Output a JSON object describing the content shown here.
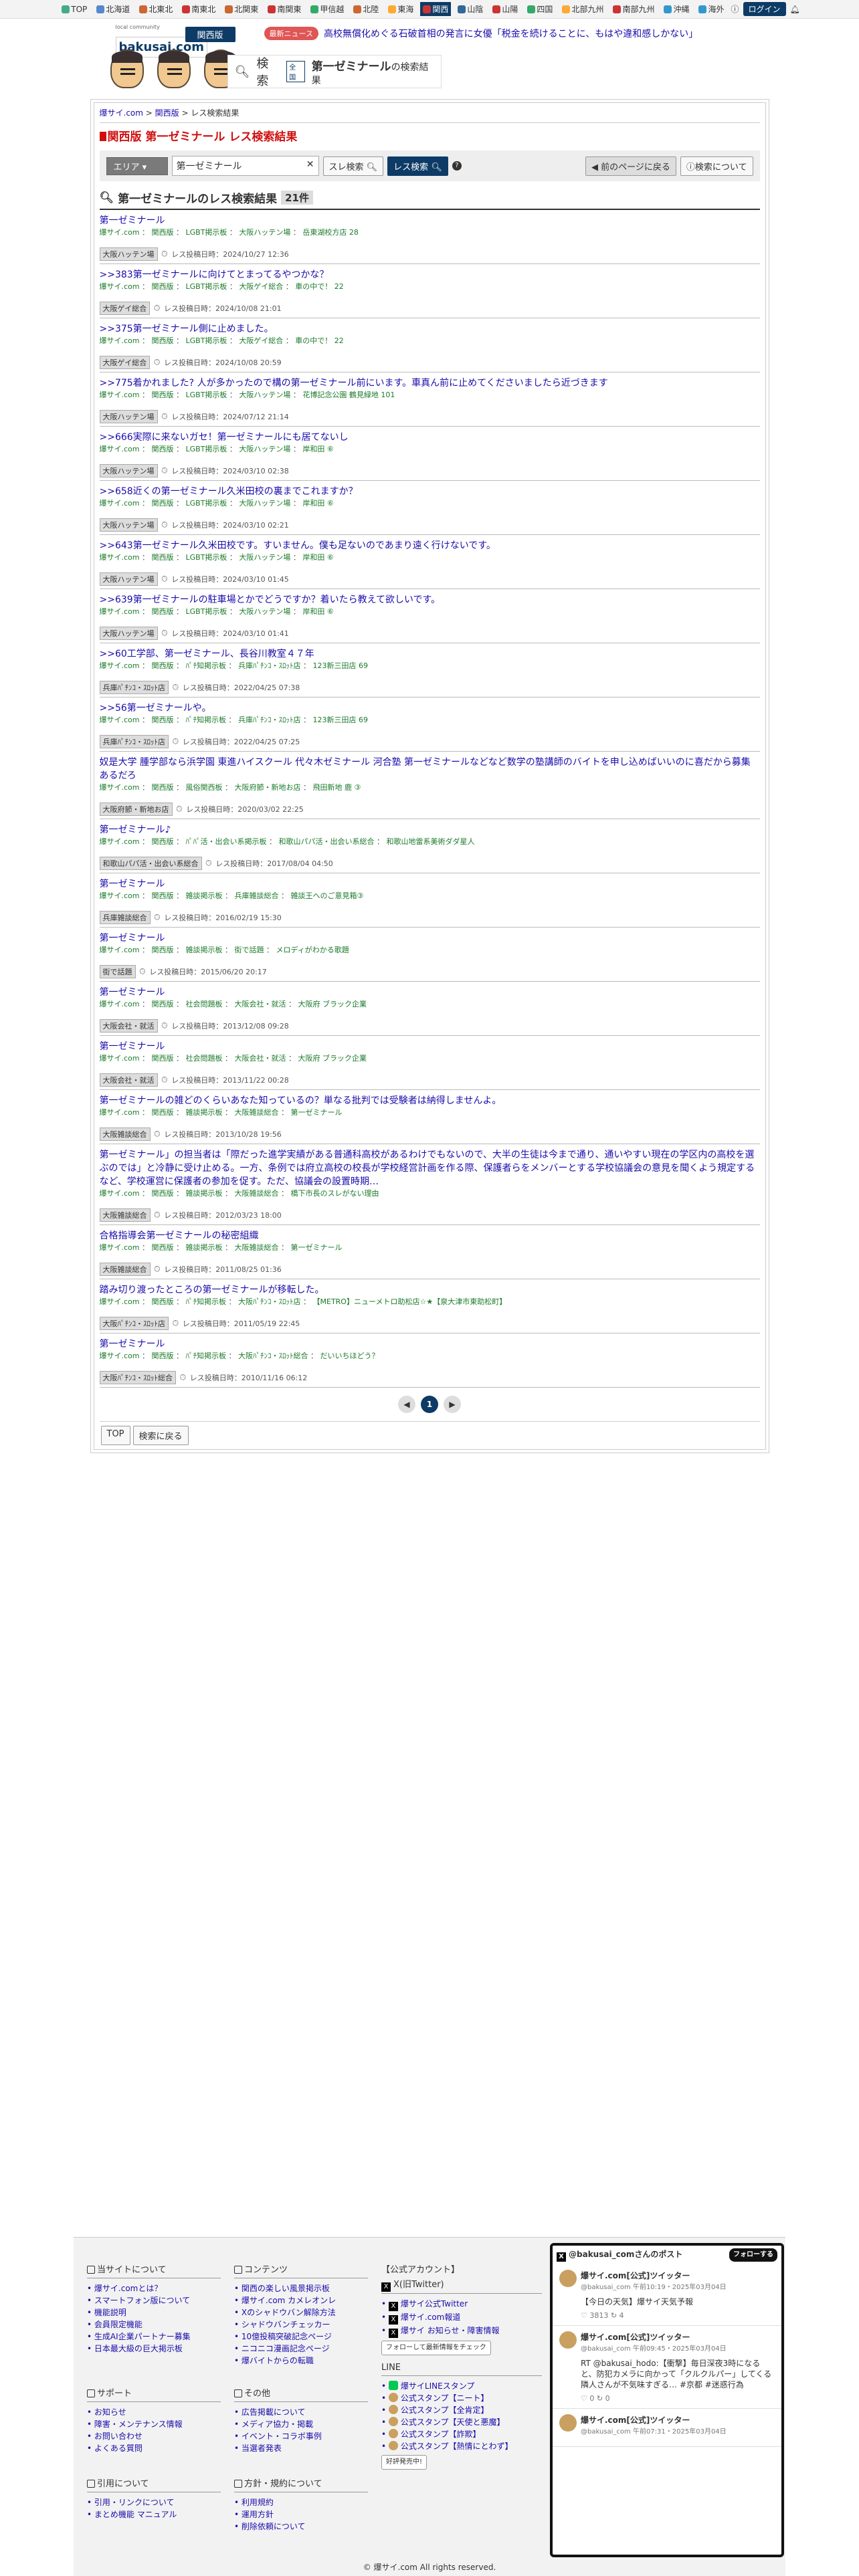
{
  "topbar": {
    "items": [
      {
        "label": "TOP",
        "color": "#4a8"
      },
      {
        "label": "北海道",
        "color": "#58c"
      },
      {
        "label": "北東北",
        "color": "#c63"
      },
      {
        "label": "南東北",
        "color": "#c33"
      },
      {
        "label": "北関東",
        "color": "#c63"
      },
      {
        "label": "南関東",
        "color": "#c33"
      },
      {
        "label": "甲信越",
        "color": "#3a6"
      },
      {
        "label": "北陸",
        "color": "#c63"
      },
      {
        "label": "東海",
        "color": "#fa3"
      },
      {
        "label": "関西",
        "color": "#c33",
        "active": true
      },
      {
        "label": "山陰",
        "color": "#369"
      },
      {
        "label": "山陽",
        "color": "#c33"
      },
      {
        "label": "四国",
        "color": "#3a6"
      },
      {
        "label": "北部九州",
        "color": "#fa3"
      },
      {
        "label": "南部九州",
        "color": "#c33"
      },
      {
        "label": "沖縄",
        "color": "#39c"
      },
      {
        "label": "海外",
        "color": "#39c"
      }
    ],
    "login": "ログイン"
  },
  "header": {
    "logo_tag": "local community",
    "logo": "bakusai.com",
    "region": "関西版",
    "news_badge": "最新ニュース",
    "news_text": "高校無償化めぐる石破首相の発言に女優「税金を続けることに、もはや違和感しかない」",
    "search_label": "検索",
    "search_all": "全国",
    "search_kw": "第一ゼミナール",
    "search_suffix": "の検索結果"
  },
  "crumb": [
    "爆サイ.com",
    "関西版",
    "レス検索結果"
  ],
  "page_title": "関西版 第一ゼミナール レス検索結果",
  "searchbar": {
    "area": "エリア",
    "query": "第一ゼミナール",
    "btn_thread": "スレ検索",
    "btn_res": "レス検索",
    "help": "?",
    "btn_back": "前のページに戻る",
    "btn_about": "検索について"
  },
  "results_title": "第一ゼミナールのレス検索結果",
  "results_count": "21件",
  "results": [
    {
      "title": "第一ゼミナール",
      "site": "爆サイ.com",
      "path": "関西版",
      "board": "LGBT掲示板",
      "sub": "大阪ハッテン場",
      "thread": "岳東湖校方店 28",
      "tag": "大阪ハッテン場",
      "date": "レス投稿日時：2024/10/27 12:36"
    },
    {
      "title": ">>383第一ゼミナールに向けてとまってるやつかな？",
      "site": "爆サイ.com",
      "path": "関西版",
      "board": "LGBT掲示板",
      "sub": "大阪ゲイ総合",
      "thread": "車の中で！ 22",
      "tag": "大阪ゲイ総合",
      "date": "レス投稿日時：2024/10/08 21:01"
    },
    {
      "title": ">>375第一ゼミナール側に止めました。",
      "site": "爆サイ.com",
      "path": "関西版",
      "board": "LGBT掲示板",
      "sub": "大阪ゲイ総合",
      "thread": "車の中で！ 22",
      "tag": "大阪ゲイ総合",
      "date": "レス投稿日時：2024/10/08 20:59"
    },
    {
      "title": ">>775着かれました? 人が多かったので構の第一ゼミナール前にいます。車真ん前に止めてくださいましたら近づきます",
      "site": "爆サイ.com",
      "path": "関西版",
      "board": "LGBT掲示板",
      "sub": "大阪ハッテン場",
      "thread": "花博記念公園 鶴見緑地 101",
      "tag": "大阪ハッテン場",
      "date": "レス投稿日時：2024/07/12 21:14"
    },
    {
      "title": ">>666実際に来ないガセ！第一ゼミナールにも居てないし",
      "site": "爆サイ.com",
      "path": "関西版",
      "board": "LGBT掲示板",
      "sub": "大阪ハッテン場",
      "thread": "岸和田 ⑥",
      "tag": "大阪ハッテン場",
      "date": "レス投稿日時：2024/03/10 02:38"
    },
    {
      "title": ">>658近くの第一ゼミナール久米田校の裏までこれますか？",
      "site": "爆サイ.com",
      "path": "関西版",
      "board": "LGBT掲示板",
      "sub": "大阪ハッテン場",
      "thread": "岸和田 ⑥",
      "tag": "大阪ハッテン場",
      "date": "レス投稿日時：2024/03/10 02:21"
    },
    {
      "title": ">>643第一ゼミナール久米田校です。すいません。僕も足ないのであまり遠く行けないです。",
      "site": "爆サイ.com",
      "path": "関西版",
      "board": "LGBT掲示板",
      "sub": "大阪ハッテン場",
      "thread": "岸和田 ⑥",
      "tag": "大阪ハッテン場",
      "date": "レス投稿日時：2024/03/10 01:45"
    },
    {
      "title": ">>639第一ゼミナールの駐車場とかでどうですか？着いたら教えて欲しいです。",
      "site": "爆サイ.com",
      "path": "関西版",
      "board": "LGBT掲示板",
      "sub": "大阪ハッテン場",
      "thread": "岸和田 ⑥",
      "tag": "大阪ハッテン場",
      "date": "レス投稿日時：2024/03/10 01:41"
    },
    {
      "title": ">>60工学部、第一ゼミナール、長谷川教室４７年",
      "site": "爆サイ.com",
      "path": "関西版",
      "board": "ﾊﾟﾁ知掲示板",
      "sub": "兵庫ﾊﾟﾁﾝｺ・ｽﾛｯﾄ店",
      "thread": "123新三田店 69",
      "tag": "兵庫ﾊﾟﾁﾝｺ・ｽﾛｯﾄ店",
      "date": "レス投稿日時：2022/04/25 07:38"
    },
    {
      "title": ">>56第一ゼミナールや。",
      "site": "爆サイ.com",
      "path": "関西版",
      "board": "ﾊﾟﾁ知掲示板",
      "sub": "兵庫ﾊﾟﾁﾝｺ・ｽﾛｯﾄ店",
      "thread": "123新三田店 69",
      "tag": "兵庫ﾊﾟﾁﾝｺ・ｽﾛｯﾄ店",
      "date": "レス投稿日時：2022/04/25 07:25"
    },
    {
      "title": "奴是大学 腫学部なら浜学園 東進ハイスクール 代々木ゼミナール 河合塾 第一ゼミナールなどなど数学の塾講師のバイトを申し込めばいいのに喜だから募集あるだろ",
      "site": "爆サイ.com",
      "path": "関西版",
      "board": "風俗関西板",
      "sub": "大阪府節・新地お店",
      "thread": "飛田新地 鹿 ③",
      "tag": "大阪府節・新地お店",
      "date": "レス投稿日時：2020/03/02 22:25"
    },
    {
      "title": "第一ゼミナール♪",
      "site": "爆サイ.com",
      "path": "関西版",
      "board": "ﾊﾟﾊﾟ活・出会い系掲示板",
      "sub": "和歌山パパ活・出会い系総合",
      "thread": "和歌山地雷系美術ダダ星人",
      "tag": "和歌山パパ活・出会い系総合",
      "date": "レス投稿日時：2017/08/04 04:50"
    },
    {
      "title": "第一ゼミナール",
      "site": "爆サイ.com",
      "path": "関西版",
      "board": "雑談掲示板",
      "sub": "兵庫雑談総合",
      "thread": "雑談王へのご意見箱③",
      "tag": "兵庫雑談総合",
      "date": "レス投稿日時：2016/02/19 15:30"
    },
    {
      "title": "第一ゼミナール",
      "site": "爆サイ.com",
      "path": "関西版",
      "board": "雑談掲示板",
      "sub": "街で話題",
      "thread": "メロディがわかる歌題",
      "tag": "街で話題",
      "date": "レス投稿日時：2015/06/20 20:17"
    },
    {
      "title": "第一ゼミナール",
      "site": "爆サイ.com",
      "path": "関西版",
      "board": "社会問題板",
      "sub": "大阪会社・就活",
      "thread": "大阪府 ブラック企業",
      "tag": "大阪会社・就活",
      "date": "レス投稿日時：2013/12/08 09:28"
    },
    {
      "title": "第一ゼミナール",
      "site": "爆サイ.com",
      "path": "関西版",
      "board": "社会問題板",
      "sub": "大阪会社・就活",
      "thread": "大阪府 ブラック企業",
      "tag": "大阪会社・就活",
      "date": "レス投稿日時：2013/11/22 00:28"
    },
    {
      "title": "第一ゼミナールの雑どのくらいあなた知っているの？単なる批判では受験者は納得しませんよ。",
      "site": "爆サイ.com",
      "path": "関西版",
      "board": "雑談掲示板",
      "sub": "大阪雑談総合",
      "thread": "第一ゼミナール",
      "tag": "大阪雑談総合",
      "date": "レス投稿日時：2013/10/28 19:56"
    },
    {
      "title": "第一ゼミナール」の担当者は「際だった進学実績がある普通科高校があるわけでもないので、大半の生徒は今まで通り、通いやすい現在の学区内の高校を選ぶのでは」と冷静に受け止める。一方、条例では府立高校の校長が学校経営計画を作る際、保護者らをメンバーとする学校協議会の意見を聞くよう規定するなど、学校運営に保護者の参加を促す。ただ、協議会の設置時期…",
      "site": "爆サイ.com",
      "path": "関西版",
      "board": "雑談掲示板",
      "sub": "大阪雑談総合",
      "thread": "橋下市長のスレがない理由",
      "tag": "大阪雑談総合",
      "date": "レス投稿日時：2012/03/23 18:00"
    },
    {
      "title": "合格指導会第一ゼミナールの秘密組織",
      "site": "爆サイ.com",
      "path": "関西版",
      "board": "雑談掲示板",
      "sub": "大阪雑談総合",
      "thread": "第一ゼミナール",
      "tag": "大阪雑談総合",
      "date": "レス投稿日時：2011/08/25 01:36"
    },
    {
      "title": "踏み切り渡ったところの第一ゼミナールが移転した。",
      "site": "爆サイ.com",
      "path": "関西版",
      "board": "ﾊﾟﾁ知掲示板",
      "sub": "大阪ﾊﾟﾁﾝｺ・ｽﾛｯﾄ店",
      "thread": "【METRO】ニューメトロ助松店☆★【泉大津市東助松町】",
      "tag": "大阪ﾊﾟﾁﾝｺ・ｽﾛｯﾄ店",
      "date": "レス投稿日時：2011/05/19 22:45"
    },
    {
      "title": "第一ゼミナール",
      "site": "爆サイ.com",
      "path": "関西版",
      "board": "ﾊﾟﾁ知掲示板",
      "sub": "大阪ﾊﾟﾁﾝｺ・ｽﾛｯﾄ総合",
      "thread": "だいいちほどう？",
      "tag": "大阪ﾊﾟﾁﾝｺ・ｽﾛｯﾄ総合",
      "date": "レス投稿日時：2010/11/16 06:12"
    }
  ],
  "pager": {
    "current": "1"
  },
  "bottom_nav": [
    "TOP",
    "検索に戻る"
  ],
  "footer": {
    "about": {
      "title": "当サイトについて",
      "links": [
        "爆サイ.comとは？",
        "スマートフォン版について",
        "機能説明",
        "会員限定機能",
        "生成AI企業パートナー募集",
        "日本最大級の巨大掲示板"
      ]
    },
    "contents": {
      "title": "コンテンツ",
      "links": [
        "関西の楽しい風景掲示板",
        "爆サイ.com カメレオンレ",
        "Xのシャドウバン解除方法",
        "シャドウバンチェッカー",
        "10億投稿突破記念ページ",
        "ニコニコ漫画記念ページ",
        "爆バイトからの転職"
      ]
    },
    "support": {
      "title": "サポート",
      "links": [
        "お知らせ",
        "障害・メンテナンス情報",
        "お問い合わせ",
        "よくある質問"
      ]
    },
    "other": {
      "title": "その他",
      "links": [
        "広告掲載について",
        "メディア協力・掲載",
        "イベント・コラボ事例",
        "当選者発表"
      ]
    },
    "links": {
      "title": "引用について",
      "links": [
        "引用・リンクについて",
        "まとめ機能 マニュアル"
      ]
    },
    "policy": {
      "title": "方針・規約について",
      "links": [
        "利用規約",
        "運用方針",
        "削除依頼について"
      ]
    },
    "accounts_title": "【公式アカウント】",
    "x_title": "X(旧Twitter)",
    "x_links": [
      "爆サイ公式Twitter",
      "爆サイ.com報道",
      "爆サイ お知らせ・障害情報"
    ],
    "follow_btn": "フォローして最新情報をチェック",
    "line_title": "LINE",
    "line_links": [
      "爆サイLINEスタンプ",
      "公式スタンプ【ニート】",
      "公式スタンプ【全肯定】",
      "公式スタンプ【天使と悪魔】",
      "公式スタンプ【詐欺】",
      "公式スタンプ【熱情にとわず】"
    ],
    "sale_btn": "好評発売中!",
    "tw_header": "@bakusai_comさんのポスト",
    "tw_follow": "フォローする",
    "tweets": [
      {
        "name": "爆サイ.com[公式]ツイッター",
        "handle": "@bakusai_com 午前10:19・2025年03月04日",
        "body": "【今日の天気】爆サイ天気予報",
        "stats": "♡ 3813   ↻ 4"
      },
      {
        "name": "爆サイ.com[公式]ツイッター",
        "handle": "@bakusai_com 午前09:45・2025年03月04日",
        "body": "RT @bakusai_hodo:【衝撃】毎日深夜3時になると、防犯カメラに向かって「クルクルパー」してくる隣人さんが不気味すぎる… #京都 #迷惑行為",
        "stats": "♡ 0   ↻ 0"
      },
      {
        "name": "爆サイ.com[公式]ツイッター",
        "handle": "@bakusai_com 午前07:31・2025年03月04日",
        "body": "",
        "stats": ""
      }
    ],
    "copyright": "© 爆サイ.com All rights reserved."
  }
}
